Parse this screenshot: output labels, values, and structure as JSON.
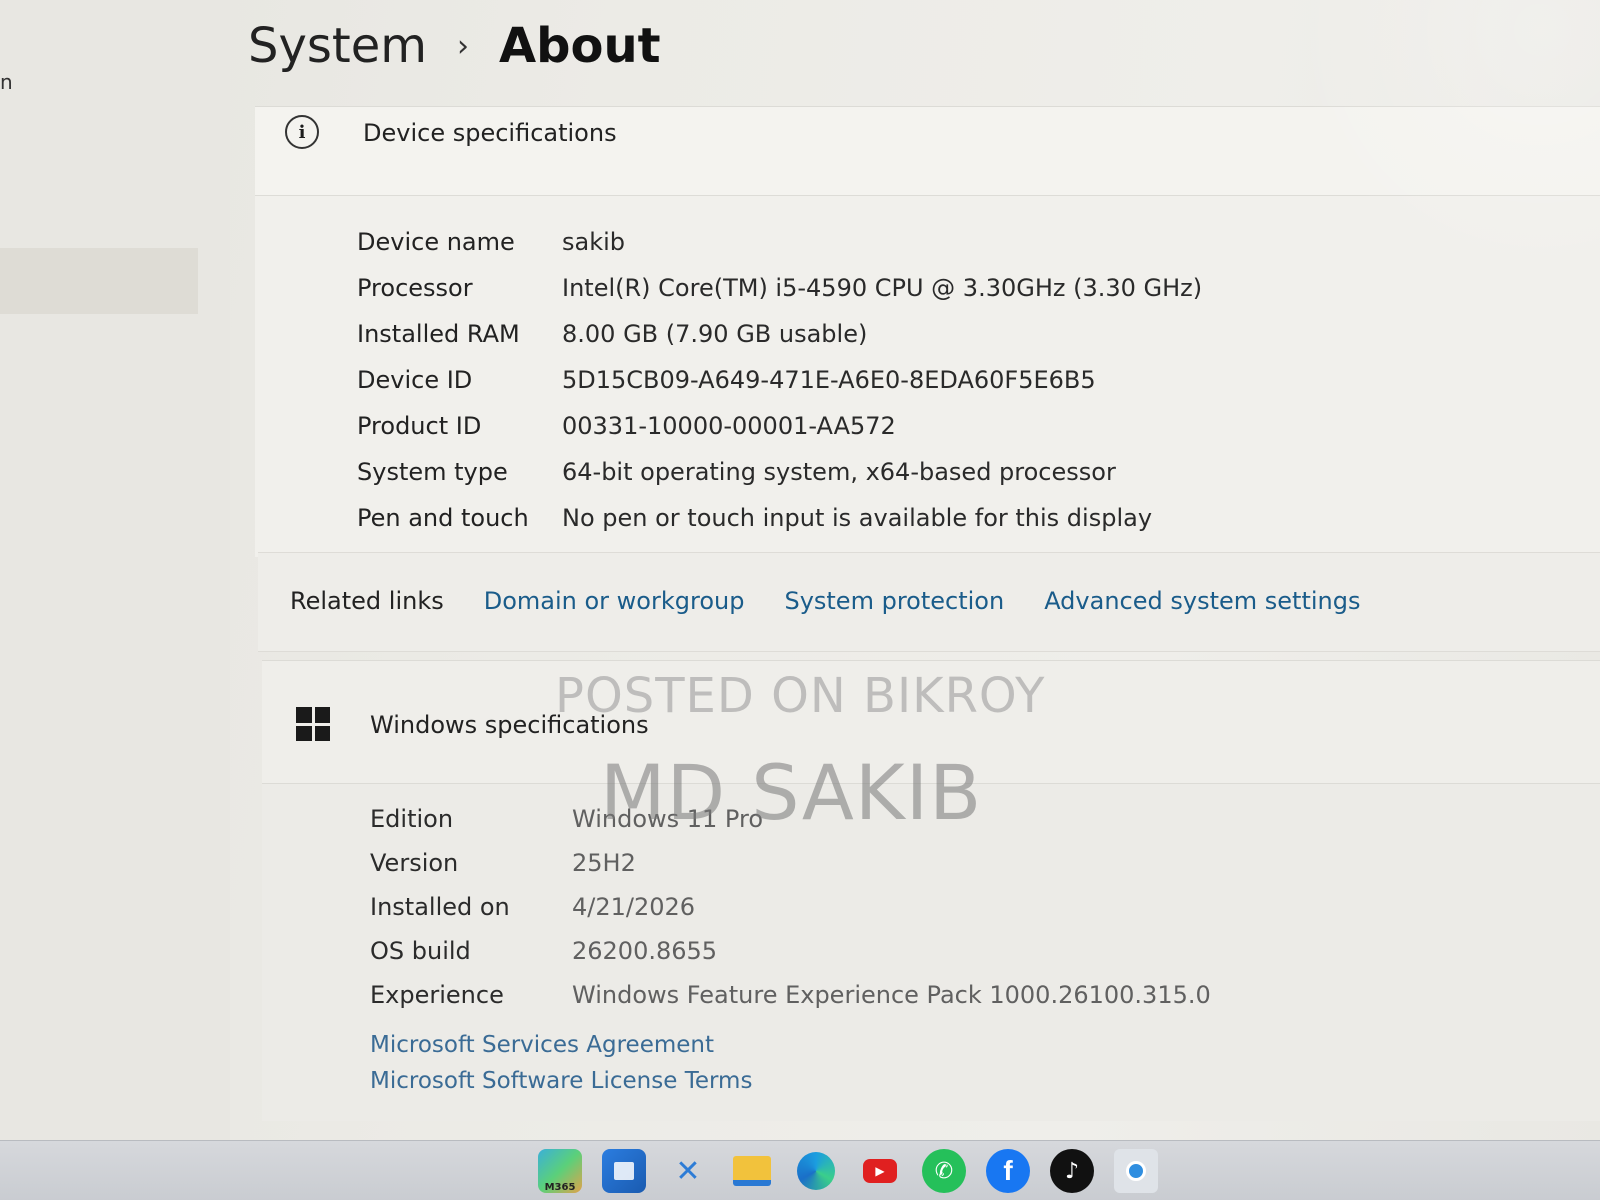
{
  "nav": {
    "cut_text": "n"
  },
  "breadcrumb": {
    "parent": "System",
    "separator": "›",
    "current": "About"
  },
  "device_specs": {
    "title": "Device specifications",
    "rows": [
      {
        "label": "Device name",
        "value": "sakib"
      },
      {
        "label": "Processor",
        "value": "Intel(R) Core(TM) i5-4590 CPU @ 3.30GHz (3.30 GHz)"
      },
      {
        "label": "Installed RAM",
        "value": "8.00 GB (7.90 GB usable)"
      },
      {
        "label": "Device ID",
        "value": "5D15CB09-A649-471E-A6E0-8EDA60F5E6B5"
      },
      {
        "label": "Product ID",
        "value": "00331-10000-00001-AA572"
      },
      {
        "label": "System type",
        "value": "64-bit operating system, x64-based processor"
      },
      {
        "label": "Pen and touch",
        "value": "No pen or touch input is available for this display"
      }
    ]
  },
  "related_links": {
    "label": "Related links",
    "links": [
      "Domain or workgroup",
      "System protection",
      "Advanced system settings"
    ]
  },
  "windows_specs": {
    "title": "Windows specifications",
    "rows": [
      {
        "label": "Edition",
        "value": "Windows 11 Pro"
      },
      {
        "label": "Version",
        "value": "25H2"
      },
      {
        "label": "Installed on",
        "value": "4/21/2026"
      },
      {
        "label": "OS build",
        "value": "26200.8655"
      },
      {
        "label": "Experience",
        "value": "Windows Feature Experience Pack 1000.26100.315.0"
      }
    ],
    "links": [
      "Microsoft Services Agreement",
      "Microsoft Software License Terms"
    ]
  },
  "watermark": {
    "line1": "POSTED ON BIKROY",
    "line2": "MD SAKIB"
  },
  "taskbar": {
    "icons": [
      "start-icon",
      "microsoft-365-icon",
      "store-icon",
      "vscode-icon",
      "file-explorer-icon",
      "edge-icon",
      "youtube-icon",
      "whatsapp-icon",
      "facebook-icon",
      "tiktok-icon",
      "active-app-icon"
    ],
    "m365_label": "M365",
    "facebook_glyph": "f",
    "tiktok_glyph": "♪",
    "whatsapp_glyph": "✆",
    "youtube_glyph": "▶"
  }
}
